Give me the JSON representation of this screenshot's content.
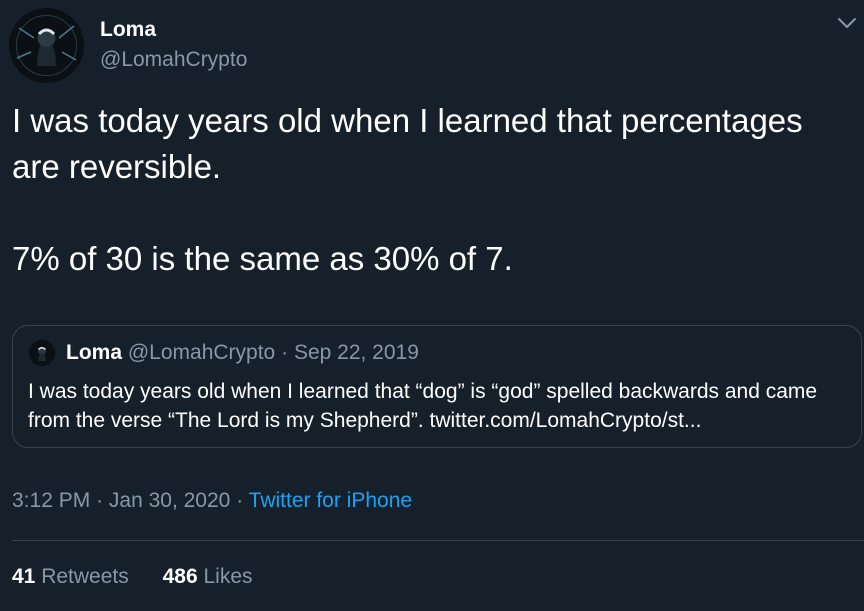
{
  "author": {
    "name": "Loma",
    "handle": "@LomahCrypto",
    "avatar_icon": "avatar-icon"
  },
  "menu_icon": "chevron-down-icon",
  "tweet": {
    "paragraphs": [
      "I was today years old when I learned that percentages are reversible.",
      "7% of 30 is the same as 30% of 7."
    ]
  },
  "quoted_tweet": {
    "name": "Loma",
    "handle": "@LomahCrypto",
    "separator": "·",
    "date": "Sep 22, 2019",
    "text": "I was today years old when I learned that “dog” is “god” spelled backwards and came from the verse “The Lord is my Shepherd”. twitter.com/LomahCrypto/st..."
  },
  "meta": {
    "time": "3:12 PM",
    "separator": "·",
    "date": "Jan 30, 2020",
    "source": "Twitter for iPhone"
  },
  "stats": {
    "retweets_count": "41",
    "retweets_label": "Retweets",
    "likes_count": "486",
    "likes_label": "Likes"
  },
  "colors": {
    "background": "#15202b",
    "secondary_text": "#8899a6",
    "link": "#1da1f2",
    "border": "#38444d"
  }
}
